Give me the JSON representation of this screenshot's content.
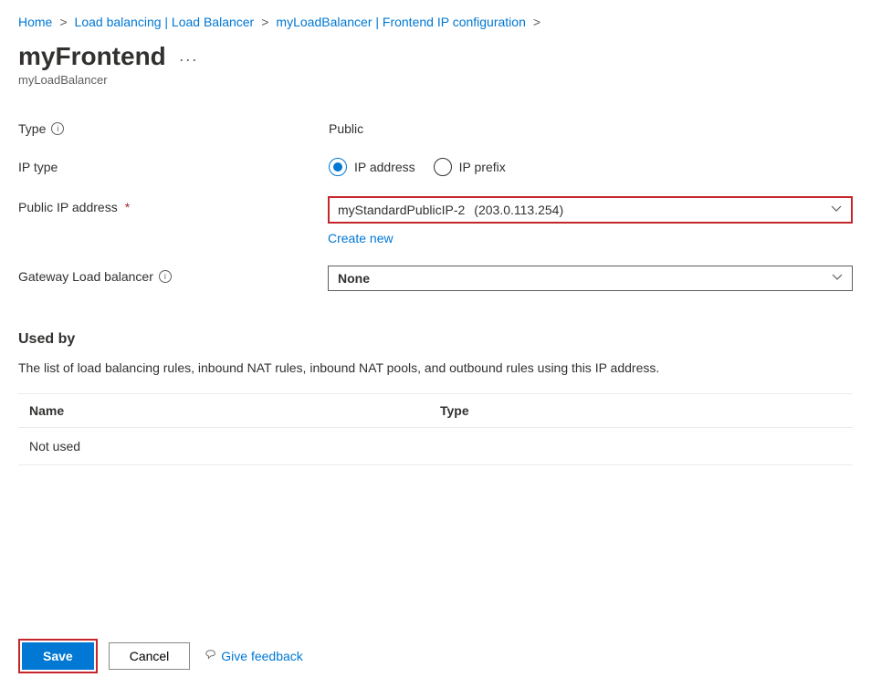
{
  "breadcrumb": {
    "home": "Home",
    "loadBalancing": "Load balancing | Load Balancer",
    "myLB": "myLoadBalancer | Frontend IP configuration"
  },
  "header": {
    "title": "myFrontend",
    "subtitle": "myLoadBalancer"
  },
  "form": {
    "typeLabel": "Type",
    "typeValue": "Public",
    "ipTypeLabel": "IP type",
    "ipTypeOptions": {
      "address": "IP address",
      "prefix": "IP prefix"
    },
    "publicIpLabel": "Public IP address",
    "publicIpValue": "myStandardPublicIP-2",
    "publicIpAddr": "(203.0.113.254)",
    "createNew": "Create new",
    "gatewayLabel": "Gateway Load balancer",
    "gatewayValue": "None"
  },
  "usedBy": {
    "heading": "Used by",
    "desc": "The list of load balancing rules, inbound NAT rules, inbound NAT pools, and outbound rules using this IP address.",
    "colName": "Name",
    "colType": "Type",
    "emptyName": "Not used"
  },
  "footer": {
    "save": "Save",
    "cancel": "Cancel",
    "feedback": "Give feedback"
  }
}
